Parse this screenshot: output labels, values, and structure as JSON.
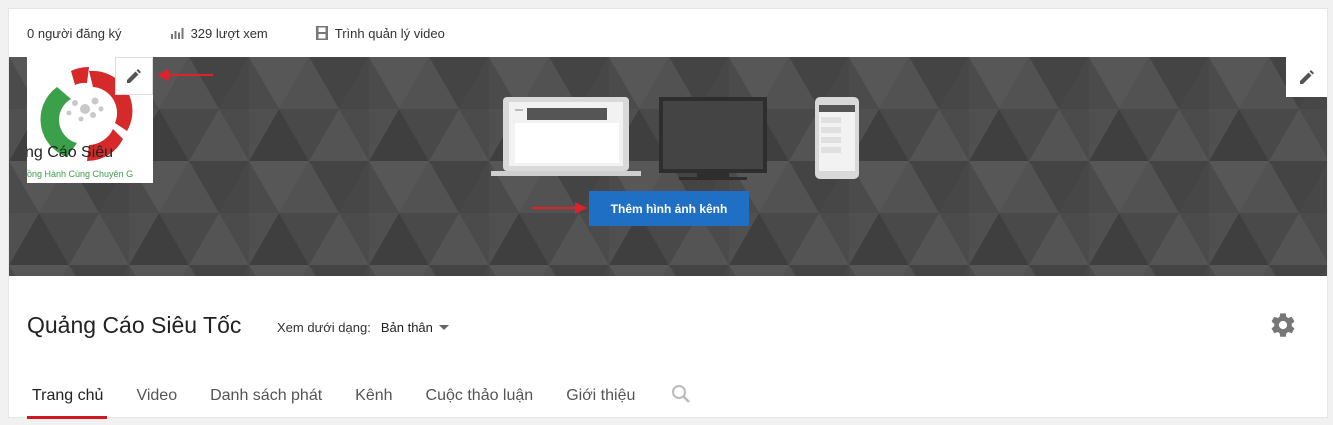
{
  "stats": {
    "subscribers": "0 người đăng ký",
    "views": "329 lượt xem",
    "video_manager": "Trình quản lý video"
  },
  "avatar": {
    "logo_text": "ng Cáo Siêu",
    "logo_tagline": "ồng Hành Cùng Chuyên G"
  },
  "banner": {
    "add_art_label": "Thêm hình ảnh kênh",
    "accent_color": "#1f6fc5",
    "annotation_arrow_color": "#e0202a"
  },
  "channel": {
    "title": "Quảng Cáo Siêu Tốc",
    "view_as_label": "Xem dưới dạng:",
    "view_as_value": "Bản thân"
  },
  "tabs": [
    {
      "label": "Trang chủ",
      "active": true
    },
    {
      "label": "Video"
    },
    {
      "label": "Danh sách phát"
    },
    {
      "label": "Kênh"
    },
    {
      "label": "Cuộc thảo luận"
    },
    {
      "label": "Giới thiệu"
    }
  ],
  "icons": {
    "views": "bar-chart-icon",
    "video_manager": "film-strip-icon",
    "edit": "pencil-icon",
    "settings": "gear-icon",
    "search": "search-icon"
  }
}
